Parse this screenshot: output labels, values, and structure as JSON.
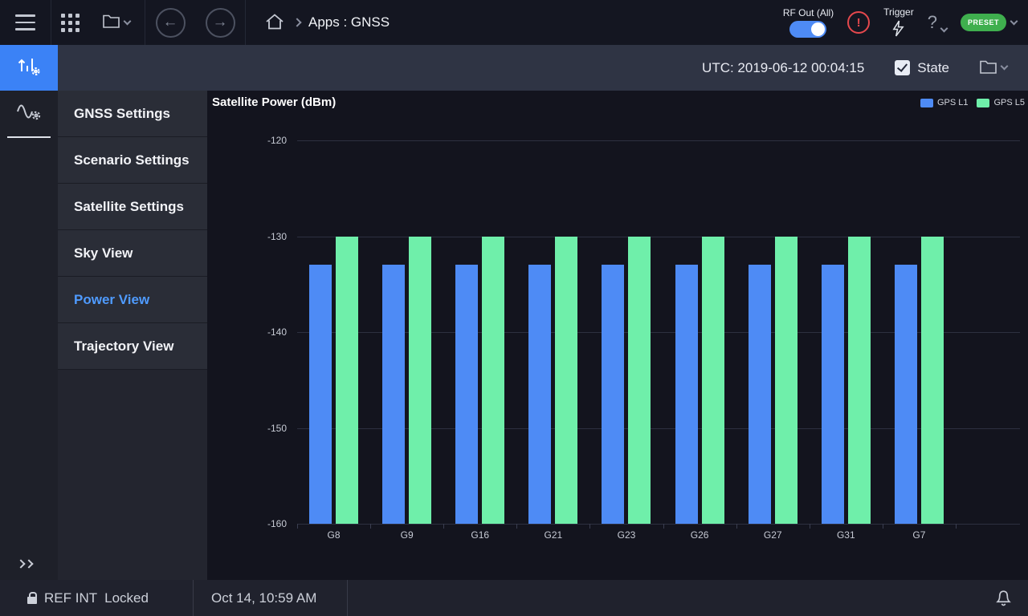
{
  "icons": {
    "back": "←",
    "forward": "→",
    "help": "?",
    "alert": "!"
  },
  "topbar": {
    "breadcrumb": "Apps : GNSS",
    "rf_out_label": "RF Out (All)",
    "rf_out_on": true,
    "trigger_label": "Trigger",
    "preset_label": "PRESET"
  },
  "utc_bar": {
    "utc_text": "UTC: 2019-06-12 00:04:15",
    "state_label": "State",
    "state_checked": true
  },
  "nav": {
    "active": "Power View",
    "items": [
      {
        "label": "GNSS Settings"
      },
      {
        "label": "Scenario Settings"
      },
      {
        "label": "Satellite Settings"
      },
      {
        "label": "Sky View"
      },
      {
        "label": "Power View"
      },
      {
        "label": "Trajectory View"
      }
    ]
  },
  "chart_data": {
    "type": "bar",
    "title": "Satellite Power (dBm)",
    "categories": [
      "G8",
      "G9",
      "G16",
      "G21",
      "G23",
      "G26",
      "G27",
      "G31",
      "G7"
    ],
    "series": [
      {
        "name": "GPS L1",
        "color": "#4e8bf5",
        "values": [
          -133,
          -133,
          -133,
          -133,
          -133,
          -133,
          -133,
          -133,
          -133
        ]
      },
      {
        "name": "GPS L5",
        "color": "#6fefaa",
        "values": [
          -130,
          -130,
          -130,
          -130,
          -130,
          -130,
          -130,
          -130,
          -130
        ]
      }
    ],
    "ylim": [
      -160,
      -120
    ],
    "yticks": [
      -120,
      -130,
      -140,
      -150,
      -160
    ],
    "grid": true,
    "legend_position": "top-right"
  },
  "statusbar": {
    "ref_label": "REF INT",
    "ref_status": "Locked",
    "datetime": "Oct 14, 10:59 AM"
  },
  "colors": {
    "accent_blue": "#3b82f6",
    "bar_blue": "#4e8bf5",
    "bar_green": "#6fefaa",
    "preset_green": "#3faf4e",
    "alert_red": "#e5484d"
  }
}
